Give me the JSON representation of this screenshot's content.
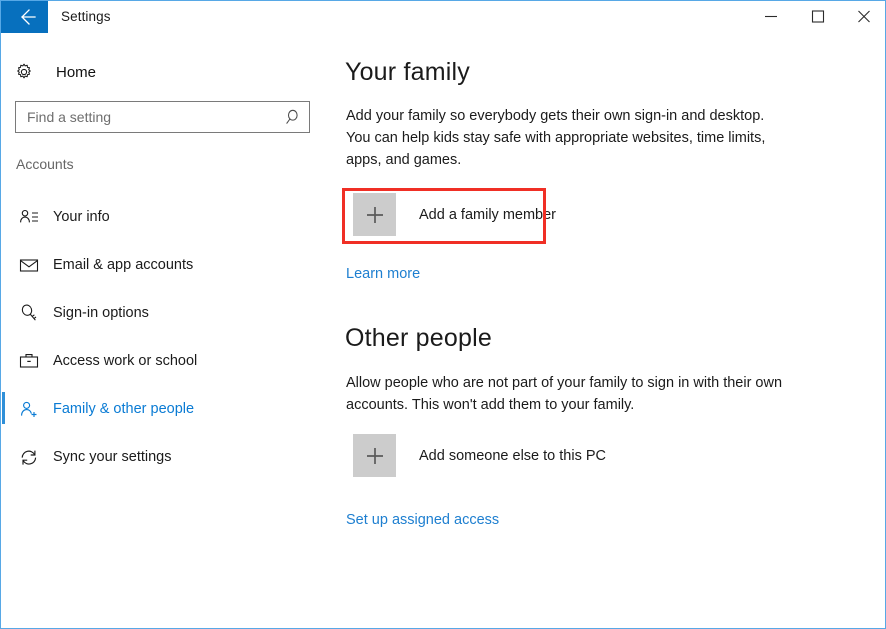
{
  "window": {
    "title": "Settings",
    "back_icon": "arrow-left-icon",
    "controls": {
      "minimize": "minimize-icon",
      "maximize": "maximize-icon",
      "close": "close-icon"
    },
    "border_color": "#57a8e6",
    "accent_color": "#0770be"
  },
  "sidebar": {
    "home": {
      "icon": "gear-icon",
      "label": "Home"
    },
    "search": {
      "icon": "search-icon",
      "placeholder": "Find a setting",
      "value": ""
    },
    "section_label": "Accounts",
    "items": [
      {
        "icon": "person-lines-icon",
        "label": "Your info",
        "selected": false
      },
      {
        "icon": "envelope-icon",
        "label": "Email & app accounts",
        "selected": false
      },
      {
        "icon": "key-icon",
        "label": "Sign-in options",
        "selected": false
      },
      {
        "icon": "briefcase-icon",
        "label": "Access work or school",
        "selected": false
      },
      {
        "icon": "person-add-icon",
        "label": "Family & other people",
        "selected": true
      },
      {
        "icon": "sync-icon",
        "label": "Sync your settings",
        "selected": false
      }
    ],
    "selected_color": "#0a7bd4"
  },
  "main": {
    "family": {
      "heading": "Your family",
      "description": "Add your family so everybody gets their own sign-in and desktop. You can help kids stay safe with appropriate websites, time limits, apps, and games.",
      "add_button": {
        "icon": "plus-icon",
        "label": "Add a family member"
      },
      "learn_more": "Learn more"
    },
    "other_people": {
      "heading": "Other people",
      "description": "Allow people who are not part of your family to sign in with their own accounts. This won't add them to your family.",
      "add_button": {
        "icon": "plus-icon",
        "label": "Add someone else to this PC"
      },
      "assigned_access": "Set up assigned access"
    }
  },
  "annotation": {
    "highlight_color": "#f02f25",
    "target": "Add a family member"
  }
}
